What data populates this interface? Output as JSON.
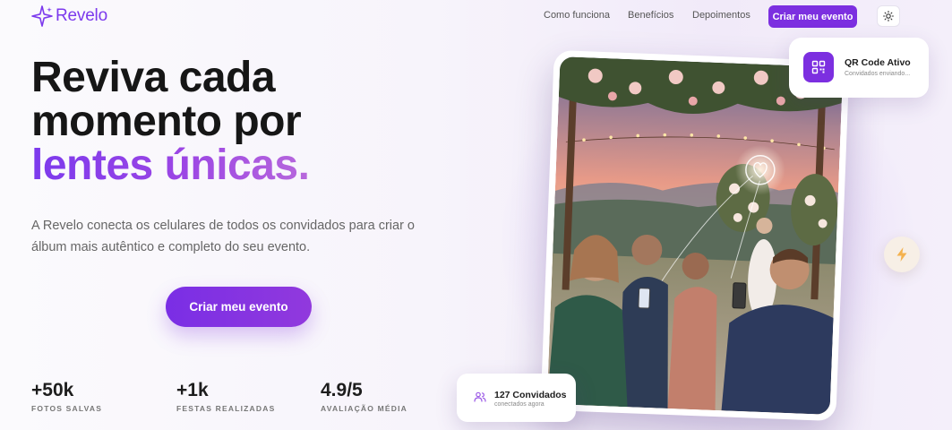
{
  "brand": {
    "name": "Revelo",
    "accent": "#7c2fe0"
  },
  "nav": {
    "links": [
      "Como funciona",
      "Benefícios",
      "Depoimentos"
    ],
    "cta": "Criar meu evento",
    "theme_icon": "sun-icon"
  },
  "hero": {
    "headline_line1": "Reviva cada",
    "headline_line2": "momento por",
    "headline_accent": "lentes únicas.",
    "subtitle": "A Revelo conecta os celulares de todos os convidados para criar o álbum mais autêntico e completo do seu evento.",
    "cta": "Criar meu evento"
  },
  "stats": [
    {
      "value": "+50k",
      "label": "FOTOS SALVAS"
    },
    {
      "value": "+1k",
      "label": "FESTAS REALIZADAS"
    },
    {
      "value": "4.9/5",
      "label": "AVALIAÇÃO MÉDIA"
    }
  ],
  "qr_card": {
    "title": "QR Code Ativo",
    "subtitle": "Convidados enviando...",
    "icon": "qr-code-icon"
  },
  "guests_card": {
    "title": "127 Convidados",
    "subtitle": "conectados agora",
    "icon": "users-icon"
  },
  "bolt_button": {
    "icon": "lightning-icon"
  },
  "photo": {
    "description_icon": "heart-icon"
  }
}
